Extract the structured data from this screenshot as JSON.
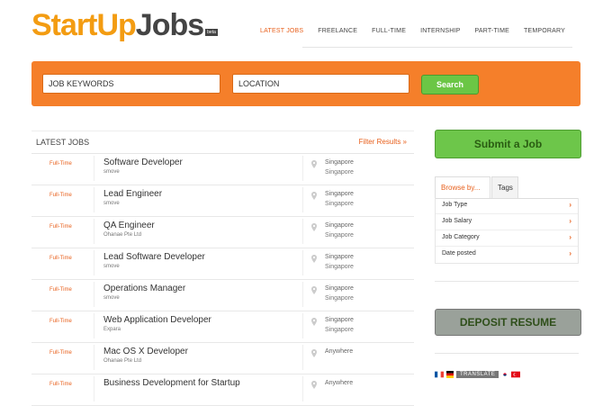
{
  "logo": {
    "part1": "StartUp",
    "part2": "Jobs",
    "badge": "beta"
  },
  "nav": [
    {
      "label": "LATEST JOBS",
      "active": true
    },
    {
      "label": "FREELANCE",
      "active": false
    },
    {
      "label": "FULL-TIME",
      "active": false
    },
    {
      "label": "INTERNSHIP",
      "active": false
    },
    {
      "label": "PART-TIME",
      "active": false
    },
    {
      "label": "TEMPORARY",
      "active": false
    }
  ],
  "search": {
    "keywords_placeholder": "JOB KEYWORDS",
    "location_placeholder": "LOCATION",
    "button": "Search"
  },
  "jobs_header": {
    "title": "LATEST JOBS",
    "filter": "Filter Results »"
  },
  "jobs": [
    {
      "type": "Full-Time",
      "title": "Software Developer",
      "company": "smove",
      "loc1": "Singapore",
      "loc2": "Singapore"
    },
    {
      "type": "Full-Time",
      "title": "Lead Engineer",
      "company": "smove",
      "loc1": "Singapore",
      "loc2": "Singapore"
    },
    {
      "type": "Full-Time",
      "title": "QA Engineer",
      "company": "Ohanae Pte Ltd",
      "loc1": "Singapore",
      "loc2": "Singapore"
    },
    {
      "type": "Full-Time",
      "title": "Lead Software Developer",
      "company": "smove",
      "loc1": "Singapore",
      "loc2": "Singapore"
    },
    {
      "type": "Full-Time",
      "title": "Operations Manager",
      "company": "smove",
      "loc1": "Singapore",
      "loc2": "Singapore"
    },
    {
      "type": "Full-Time",
      "title": "Web Application Developer",
      "company": "Expara",
      "loc1": "Singapore",
      "loc2": "Singapore"
    },
    {
      "type": "Full-Time",
      "title": "Mac OS X Developer",
      "company": "Ohanae Pte Ltd",
      "loc1": "Anywhere",
      "loc2": ""
    },
    {
      "type": "Full-Time",
      "title": "Business Development for Startup",
      "company": "",
      "loc1": "Anywhere",
      "loc2": ""
    }
  ],
  "sidebar": {
    "submit": "Submit a Job",
    "browse_tab": "Browse by...",
    "tags_tab": "Tags",
    "browse_items": [
      "Job Type",
      "Job Salary",
      "Job Category",
      "Date posted"
    ],
    "deposit": "DEPOSIT RESUME",
    "translate": "TRANSLATE"
  },
  "colors": {
    "accent": "#f57f2a",
    "green": "#6dc64a",
    "link": "#e8601c"
  }
}
